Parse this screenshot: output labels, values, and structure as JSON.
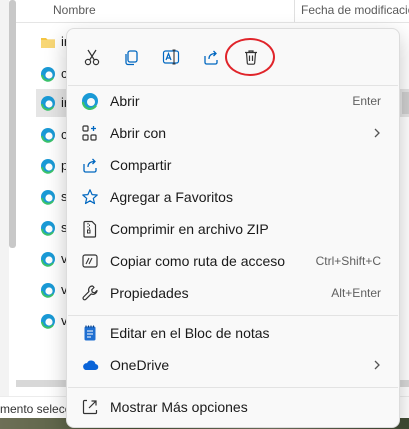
{
  "explorer": {
    "columns": {
      "name": "Nombre",
      "date": "Fecha de modificación"
    },
    "rows": [
      {
        "type": "folder",
        "char": "ir",
        "selected": false
      },
      {
        "type": "edge",
        "char": "c",
        "selected": false
      },
      {
        "type": "edge",
        "char": "ir",
        "selected": true
      },
      {
        "type": "edge",
        "char": "c",
        "selected": false
      },
      {
        "type": "edge",
        "char": "p",
        "selected": false
      },
      {
        "type": "edge",
        "char": "s",
        "selected": false
      },
      {
        "type": "edge",
        "char": "s",
        "selected": false
      },
      {
        "type": "edge",
        "char": "v",
        "selected": false
      },
      {
        "type": "edge",
        "char": "v",
        "selected": false
      },
      {
        "type": "edge",
        "char": "v",
        "selected": false
      }
    ],
    "status_text": "mento selecci"
  },
  "context_menu": {
    "quick_actions": [
      {
        "name": "cut-button",
        "icon": "scissors-icon"
      },
      {
        "name": "copy-button",
        "icon": "copy-icon"
      },
      {
        "name": "rename-button",
        "icon": "rename-icon"
      },
      {
        "name": "share-button",
        "icon": "share-icon"
      },
      {
        "name": "delete-button",
        "icon": "trash-icon",
        "highlighted": true
      }
    ],
    "items": [
      {
        "label": "Abrir",
        "shortcut": "Enter",
        "icon": "edge-icon"
      },
      {
        "label": "Abrir con",
        "submenu": true,
        "icon": "open-with-icon"
      },
      {
        "label": "Compartir",
        "icon": "share-icon"
      },
      {
        "label": "Agregar a Favoritos",
        "icon": "star-icon"
      },
      {
        "label": "Comprimir en archivo ZIP",
        "icon": "zip-icon"
      },
      {
        "label": "Copiar como ruta de acceso",
        "shortcut": "Ctrl+Shift+C",
        "icon": "copy-path-icon"
      },
      {
        "label": "Propiedades",
        "shortcut": "Alt+Enter",
        "icon": "wrench-icon"
      },
      {
        "label": "Editar en el Bloc de notas",
        "icon": "notepad-icon"
      },
      {
        "label": "OneDrive",
        "submenu": true,
        "icon": "cloud-icon"
      },
      {
        "label": "Mostrar Más opciones",
        "icon": "more-options-icon"
      }
    ],
    "colors": {
      "accent": "#0067c0",
      "highlight_ring": "#e0242a"
    }
  }
}
